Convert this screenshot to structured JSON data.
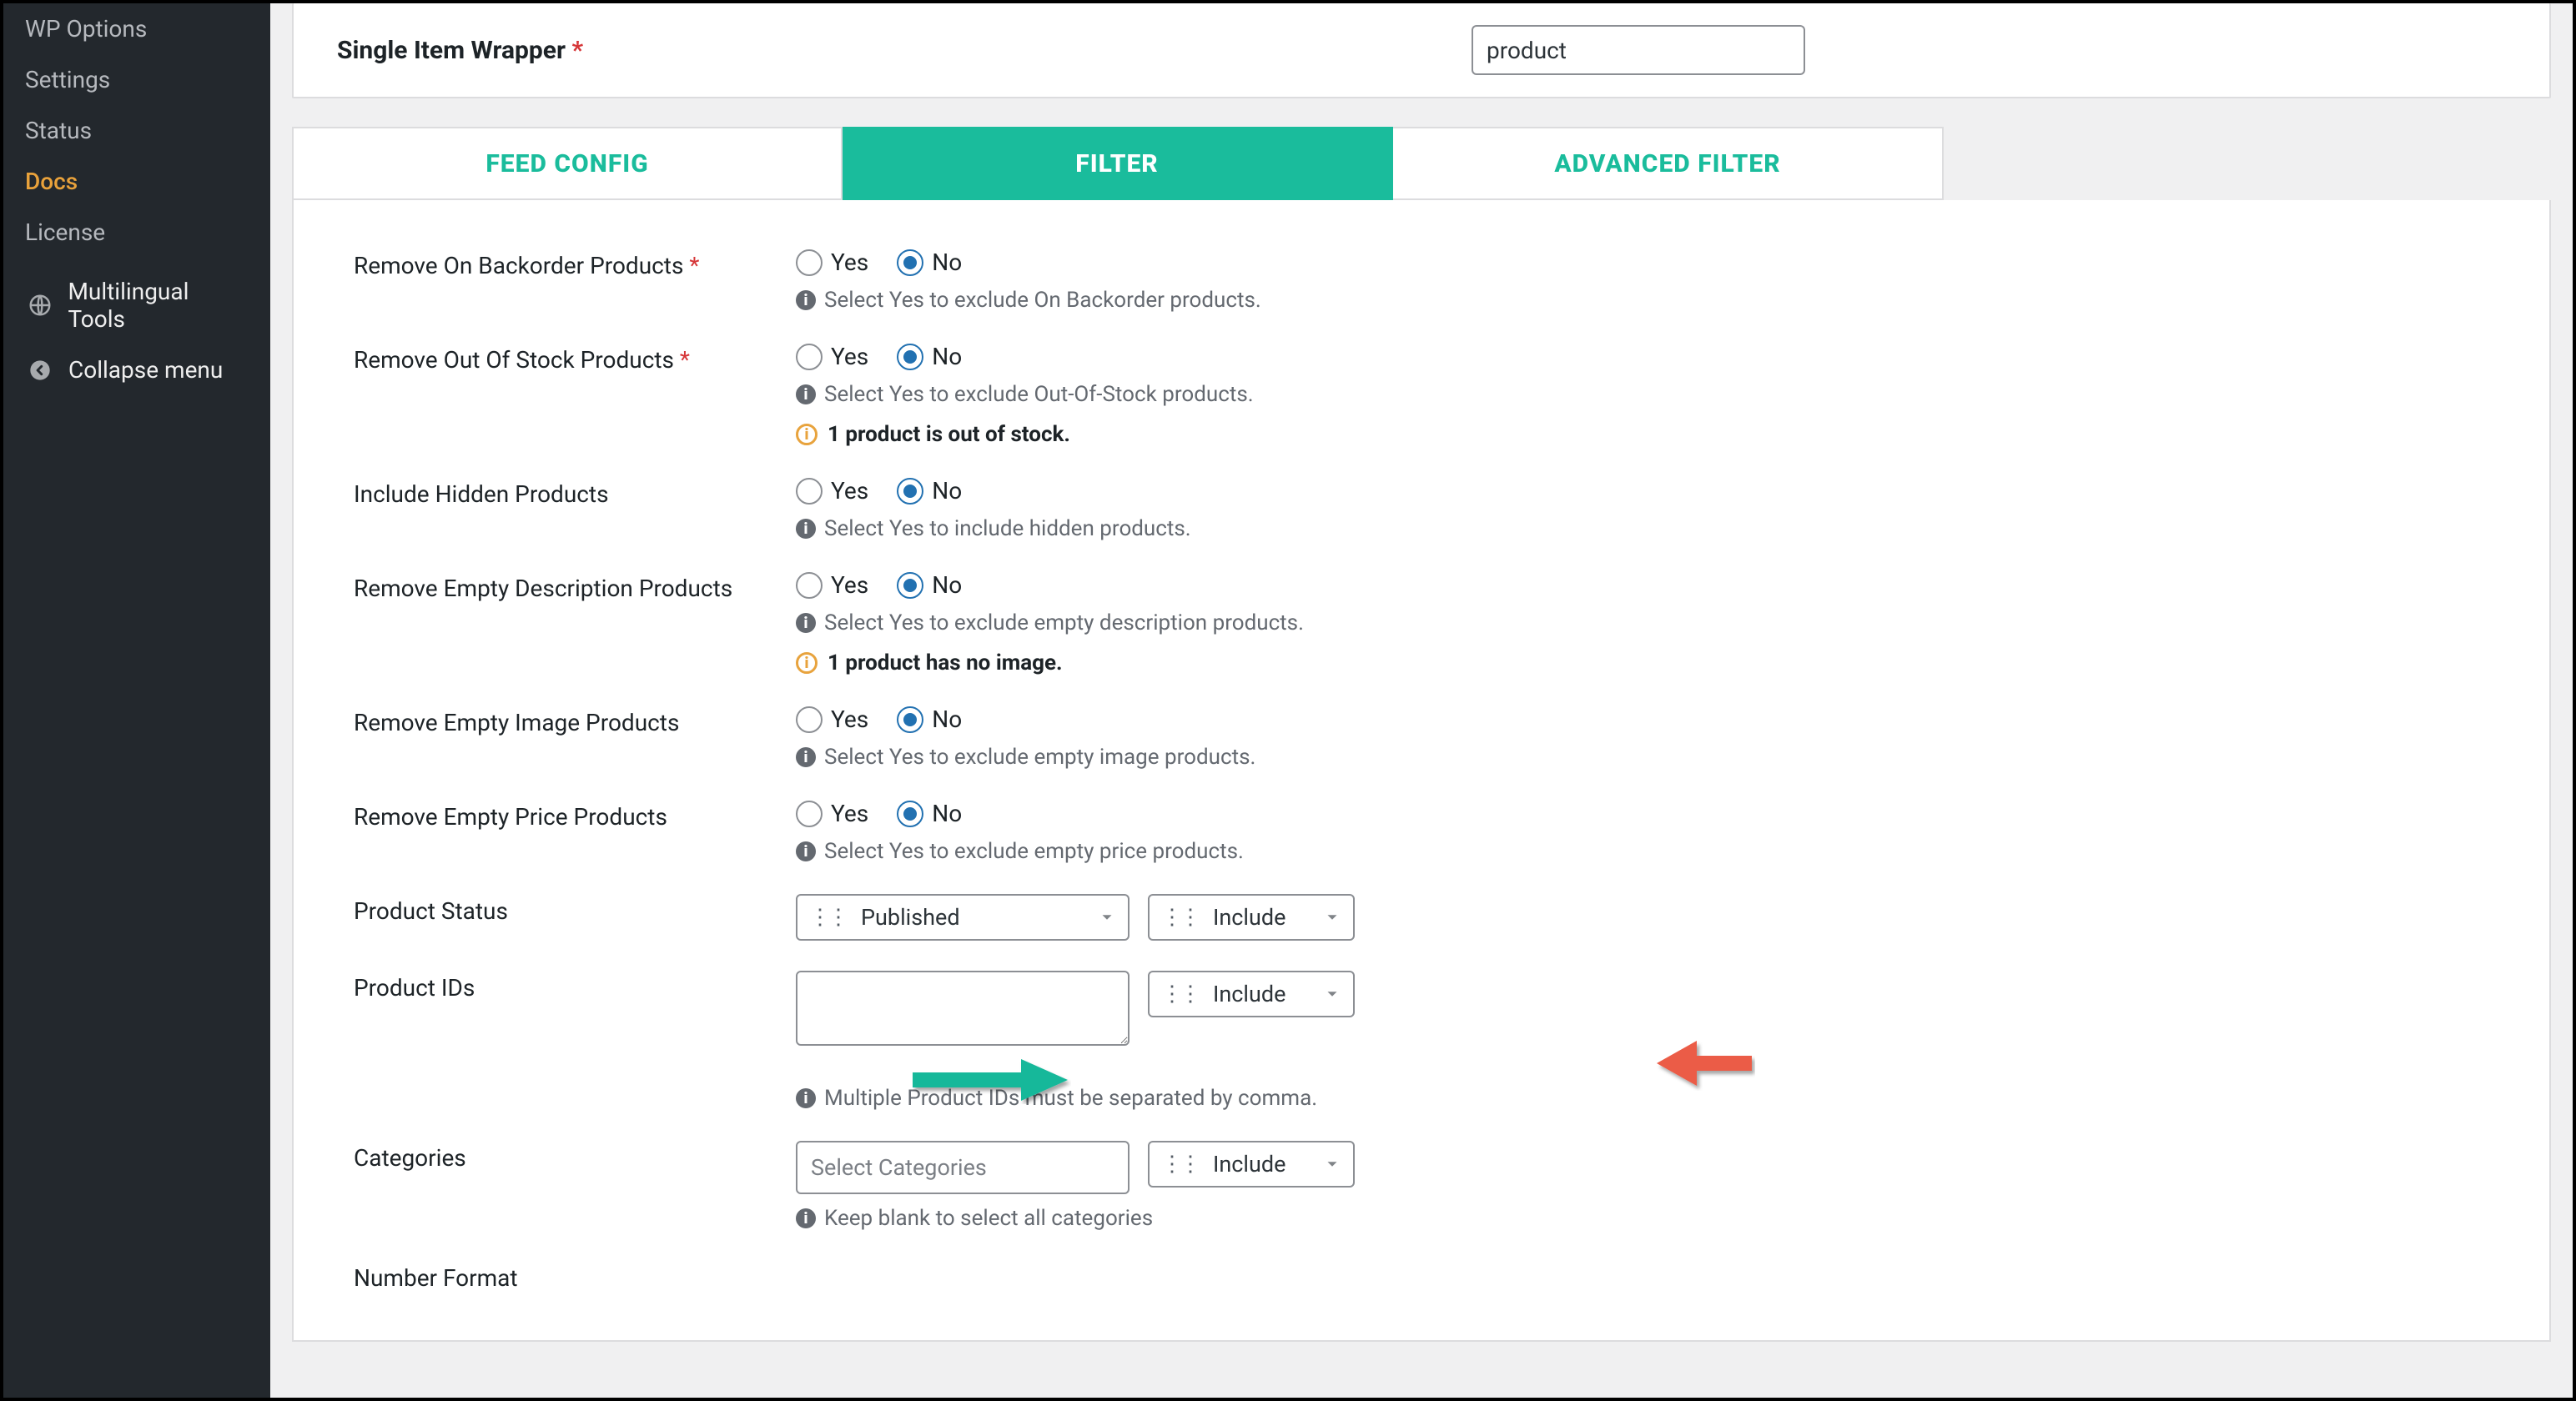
{
  "sidebar": {
    "items": [
      {
        "label": "WP Options"
      },
      {
        "label": "Settings"
      },
      {
        "label": "Status"
      },
      {
        "label": "Docs",
        "active": true
      },
      {
        "label": "License"
      }
    ],
    "multilingual": "Multilingual Tools",
    "collapse": "Collapse menu"
  },
  "topPanel": {
    "label": "Single Item Wrapper",
    "value": "product"
  },
  "tabs": {
    "feed": "FEED CONFIG",
    "filter": "FILTER",
    "advanced": "ADVANCED FILTER"
  },
  "radios": {
    "yes": "Yes",
    "no": "No"
  },
  "rows": {
    "backorder": {
      "label": "Remove On Backorder Products",
      "hint": "Select Yes to exclude On Backorder products."
    },
    "oos": {
      "label": "Remove Out Of Stock Products",
      "hint": "Select Yes to exclude Out-Of-Stock products.",
      "warn": "1 product is out of stock."
    },
    "hidden": {
      "label": "Include Hidden Products",
      "hint": "Select Yes to include hidden products."
    },
    "emptydesc": {
      "label": "Remove Empty Description Products",
      "hint": "Select Yes to exclude empty description products.",
      "warn": "1 product has no image."
    },
    "emptyimg": {
      "label": "Remove Empty Image Products",
      "hint": "Select Yes to exclude empty image products."
    },
    "emptyprice": {
      "label": "Remove Empty Price Products",
      "hint": "Select Yes to exclude empty price products."
    },
    "status": {
      "label": "Product Status",
      "value": "Published",
      "mode": "Include"
    },
    "ids": {
      "label": "Product IDs",
      "mode": "Include",
      "hint": "Multiple Product IDs must be separated by comma."
    },
    "cats": {
      "label": "Categories",
      "placeholder": "Select Categories",
      "mode": "Include",
      "hint": "Keep blank to select all categories"
    },
    "numfmt": {
      "label": "Number Format"
    }
  }
}
